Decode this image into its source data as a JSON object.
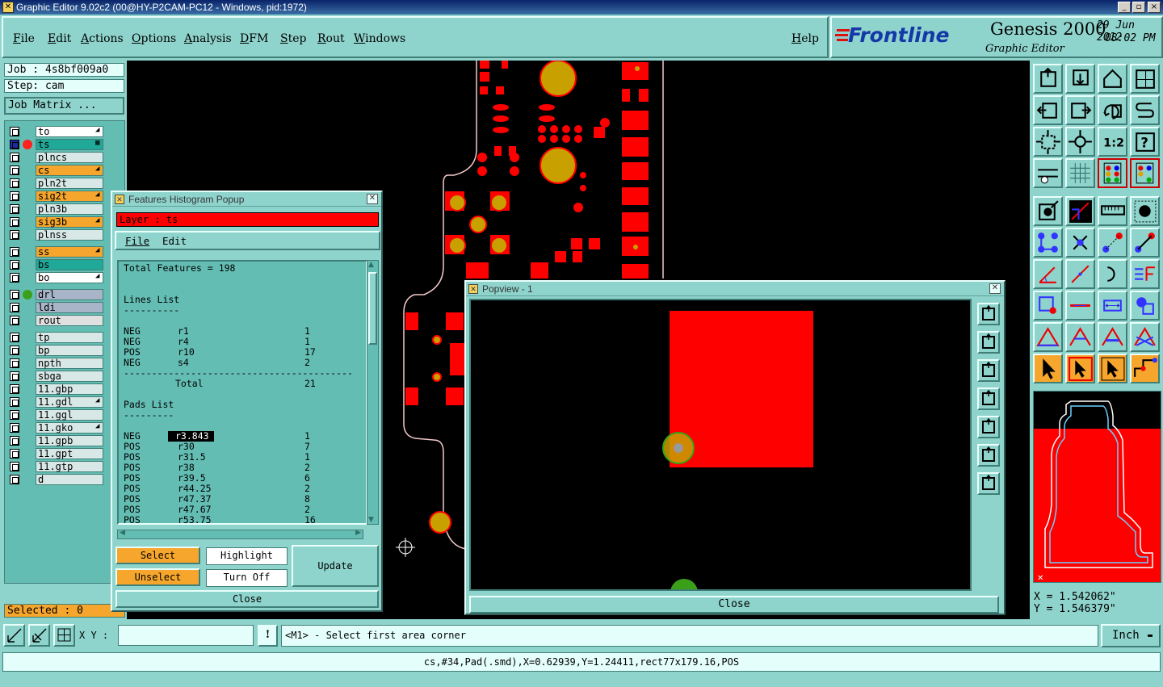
{
  "window": {
    "title": "Graphic Editor 9.02c2 (00@HY-P2CAM-PC12 - Windows, pid:1972)",
    "controls": [
      "_",
      "▫",
      "×"
    ]
  },
  "menu": [
    "File",
    "Edit",
    "Actions",
    "Options",
    "Analysis",
    "DFM",
    "Step",
    "Rout",
    "Windows"
  ],
  "help_label": "Help",
  "brand": {
    "logo": "Frontline",
    "product": "Genesis 2000",
    "subtitle": "Graphic Editor",
    "date": "29 Jun 2012",
    "time": "08:02 PM"
  },
  "job": {
    "job_label": "Job : 4s8bf009a0",
    "step_label": "Step: cam",
    "matrix_button": "Job Matrix ..."
  },
  "layers": [
    {
      "name": "to",
      "color": "#ffffff",
      "mark": "◢"
    },
    {
      "name": "ts",
      "color": "#20a898",
      "mark": "▦",
      "active": true
    },
    {
      "name": "plncs",
      "color": "#d8e8e6",
      "mark": ""
    },
    {
      "name": "cs",
      "color": "#f6a62c",
      "mark": "◢"
    },
    {
      "name": "pln2t",
      "color": "#d8e8e6",
      "mark": ""
    },
    {
      "name": "sig2t",
      "color": "#f6a62c",
      "mark": "◢"
    },
    {
      "name": "pln3b",
      "color": "#d8e8e6",
      "mark": ""
    },
    {
      "name": "sig3b",
      "color": "#f6a62c",
      "mark": "◢"
    },
    {
      "name": "plnss",
      "color": "#d8e8e6",
      "mark": ""
    },
    {
      "name": "ss",
      "color": "#f6a62c",
      "mark": "◢"
    },
    {
      "name": "bs",
      "color": "#20a898",
      "mark": ""
    },
    {
      "name": "bo",
      "color": "#ffffff",
      "mark": "◢"
    },
    {
      "name": "drl",
      "color": "#a8b4c8",
      "mark": ""
    },
    {
      "name": "ldi",
      "color": "#a8b4c8",
      "mark": ""
    },
    {
      "name": "rout",
      "color": "#e0e0e0",
      "mark": ""
    },
    {
      "name": "tp",
      "color": "#d8e8e6",
      "mark": ""
    },
    {
      "name": "bp",
      "color": "#d8e8e6",
      "mark": ""
    },
    {
      "name": "npth",
      "color": "#d8e8e6",
      "mark": ""
    },
    {
      "name": "sbga",
      "color": "#d8e8e6",
      "mark": ""
    },
    {
      "name": "11.gbp",
      "color": "#d8e8e6",
      "mark": ""
    },
    {
      "name": "11.gdl",
      "color": "#d8e8e6",
      "mark": "◢"
    },
    {
      "name": "11.ggl",
      "color": "#d8e8e6",
      "mark": ""
    },
    {
      "name": "11.gko",
      "color": "#d8e8e6",
      "mark": "◢"
    },
    {
      "name": "11.gpb",
      "color": "#d8e8e6",
      "mark": ""
    },
    {
      "name": "11.gpt",
      "color": "#d8e8e6",
      "mark": ""
    },
    {
      "name": "11.gtp",
      "color": "#d8e8e6",
      "mark": ""
    },
    {
      "name": "d",
      "color": "#d8e8e6",
      "mark": ""
    }
  ],
  "selected_label": "Selected : 0",
  "histogram": {
    "title": "Features Histogram Popup",
    "layer_label": "Layer :  ts",
    "menu_file": "File",
    "menu_edit": "Edit",
    "total_features": "Total Features = 198",
    "lines_title": "Lines List",
    "lines": [
      {
        "pol": "NEG",
        "sym": "r1",
        "count": "1"
      },
      {
        "pol": "NEG",
        "sym": "r4",
        "count": "1"
      },
      {
        "pol": "POS",
        "sym": "r10",
        "count": "17"
      },
      {
        "pol": "NEG",
        "sym": "s4",
        "count": "2"
      }
    ],
    "total_label": "Total",
    "total_value": "21",
    "pads_title": "Pads List",
    "pads": [
      {
        "pol": "NEG",
        "sym": "r3.843",
        "count": "1",
        "selected": true
      },
      {
        "pol": "POS",
        "sym": "r30",
        "count": "7"
      },
      {
        "pol": "POS",
        "sym": "r31.5",
        "count": "1"
      },
      {
        "pol": "POS",
        "sym": "r38",
        "count": "2"
      },
      {
        "pol": "POS",
        "sym": "r39.5",
        "count": "6"
      },
      {
        "pol": "POS",
        "sym": "r44.25",
        "count": "2"
      },
      {
        "pol": "POS",
        "sym": "r47.37",
        "count": "8"
      },
      {
        "pol": "POS",
        "sym": "r47.67",
        "count": "2"
      },
      {
        "pol": "POS",
        "sym": "r53.75",
        "count": "16"
      }
    ],
    "select_btn": "Select",
    "unselect_btn": "Unselect",
    "highlight_btn": "Highlight",
    "turnoff_btn": "Turn Off",
    "update_btn": "Update",
    "close_btn": "Close"
  },
  "popview": {
    "title": "Popview - 1",
    "close_btn": "Close"
  },
  "coords": {
    "x": "X = 1.542062\"",
    "y": "Y = 1.546379\""
  },
  "bottom": {
    "xy_label": "X Y :",
    "xy_value": "",
    "prompt": "<M1> - Select first area corner",
    "units": "Inch"
  },
  "status": "cs,#34,Pad(.smd),X=0.62939,Y=1.24411,rect77x179.16,POS",
  "colors": {
    "panel": "#8fd4cc",
    "feature_red": "#ff0000",
    "pad_gold": "#c8a000",
    "accent_orange": "#f6a62c"
  }
}
